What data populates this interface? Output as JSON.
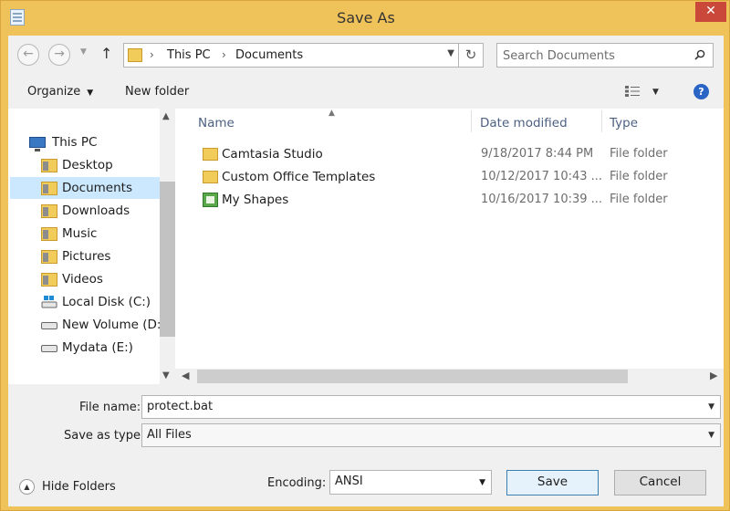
{
  "window": {
    "title": "Save As",
    "close_glyph": "✕"
  },
  "address": {
    "segments": [
      "This PC",
      "Documents"
    ],
    "separator": "›"
  },
  "search": {
    "placeholder": "Search Documents"
  },
  "toolbar": {
    "organize_label": "Organize",
    "new_folder_label": "New folder",
    "help_glyph": "?"
  },
  "nav_pane": {
    "items": [
      {
        "label": "This PC",
        "icon": "computer-icon",
        "level": 0
      },
      {
        "label": "Desktop",
        "icon": "folder-icon",
        "level": 1
      },
      {
        "label": "Documents",
        "icon": "folder-icon",
        "level": 1,
        "selected": true
      },
      {
        "label": "Downloads",
        "icon": "folder-icon",
        "level": 1
      },
      {
        "label": "Music",
        "icon": "folder-icon",
        "level": 1
      },
      {
        "label": "Pictures",
        "icon": "folder-icon",
        "level": 1
      },
      {
        "label": "Videos",
        "icon": "folder-icon",
        "level": 1
      },
      {
        "label": "Local Disk (C:)",
        "icon": "drive-icon",
        "level": 1
      },
      {
        "label": "New Volume (D:)",
        "icon": "drive-icon",
        "level": 1
      },
      {
        "label": "Mydata (E:)",
        "icon": "drive-icon",
        "level": 1
      }
    ]
  },
  "file_list": {
    "columns": [
      "Name",
      "Date modified",
      "Type"
    ],
    "rows": [
      {
        "name": "Camtasia Studio",
        "date": "9/18/2017 8:44 PM",
        "type": "File folder",
        "icon": "folder-icon"
      },
      {
        "name": "Custom Office Templates",
        "date": "10/12/2017 10:43 ...",
        "type": "File folder",
        "icon": "folder-icon"
      },
      {
        "name": "My Shapes",
        "date": "10/16/2017 10:39 ...",
        "type": "File folder",
        "icon": "shapes-folder-icon"
      }
    ]
  },
  "save_form": {
    "file_name_label": "File name:",
    "file_name_value": "protect.bat",
    "save_as_type_label": "Save as type:",
    "save_as_type_value": "All Files",
    "encoding_label": "Encoding:",
    "encoding_value": "ANSI"
  },
  "footer": {
    "hide_folders_label": "Hide Folders",
    "save_label": "Save",
    "cancel_label": "Cancel"
  },
  "colors": {
    "accent": "#2a64c5",
    "selection": "#cce8ff",
    "frame": "#f0c25a"
  }
}
